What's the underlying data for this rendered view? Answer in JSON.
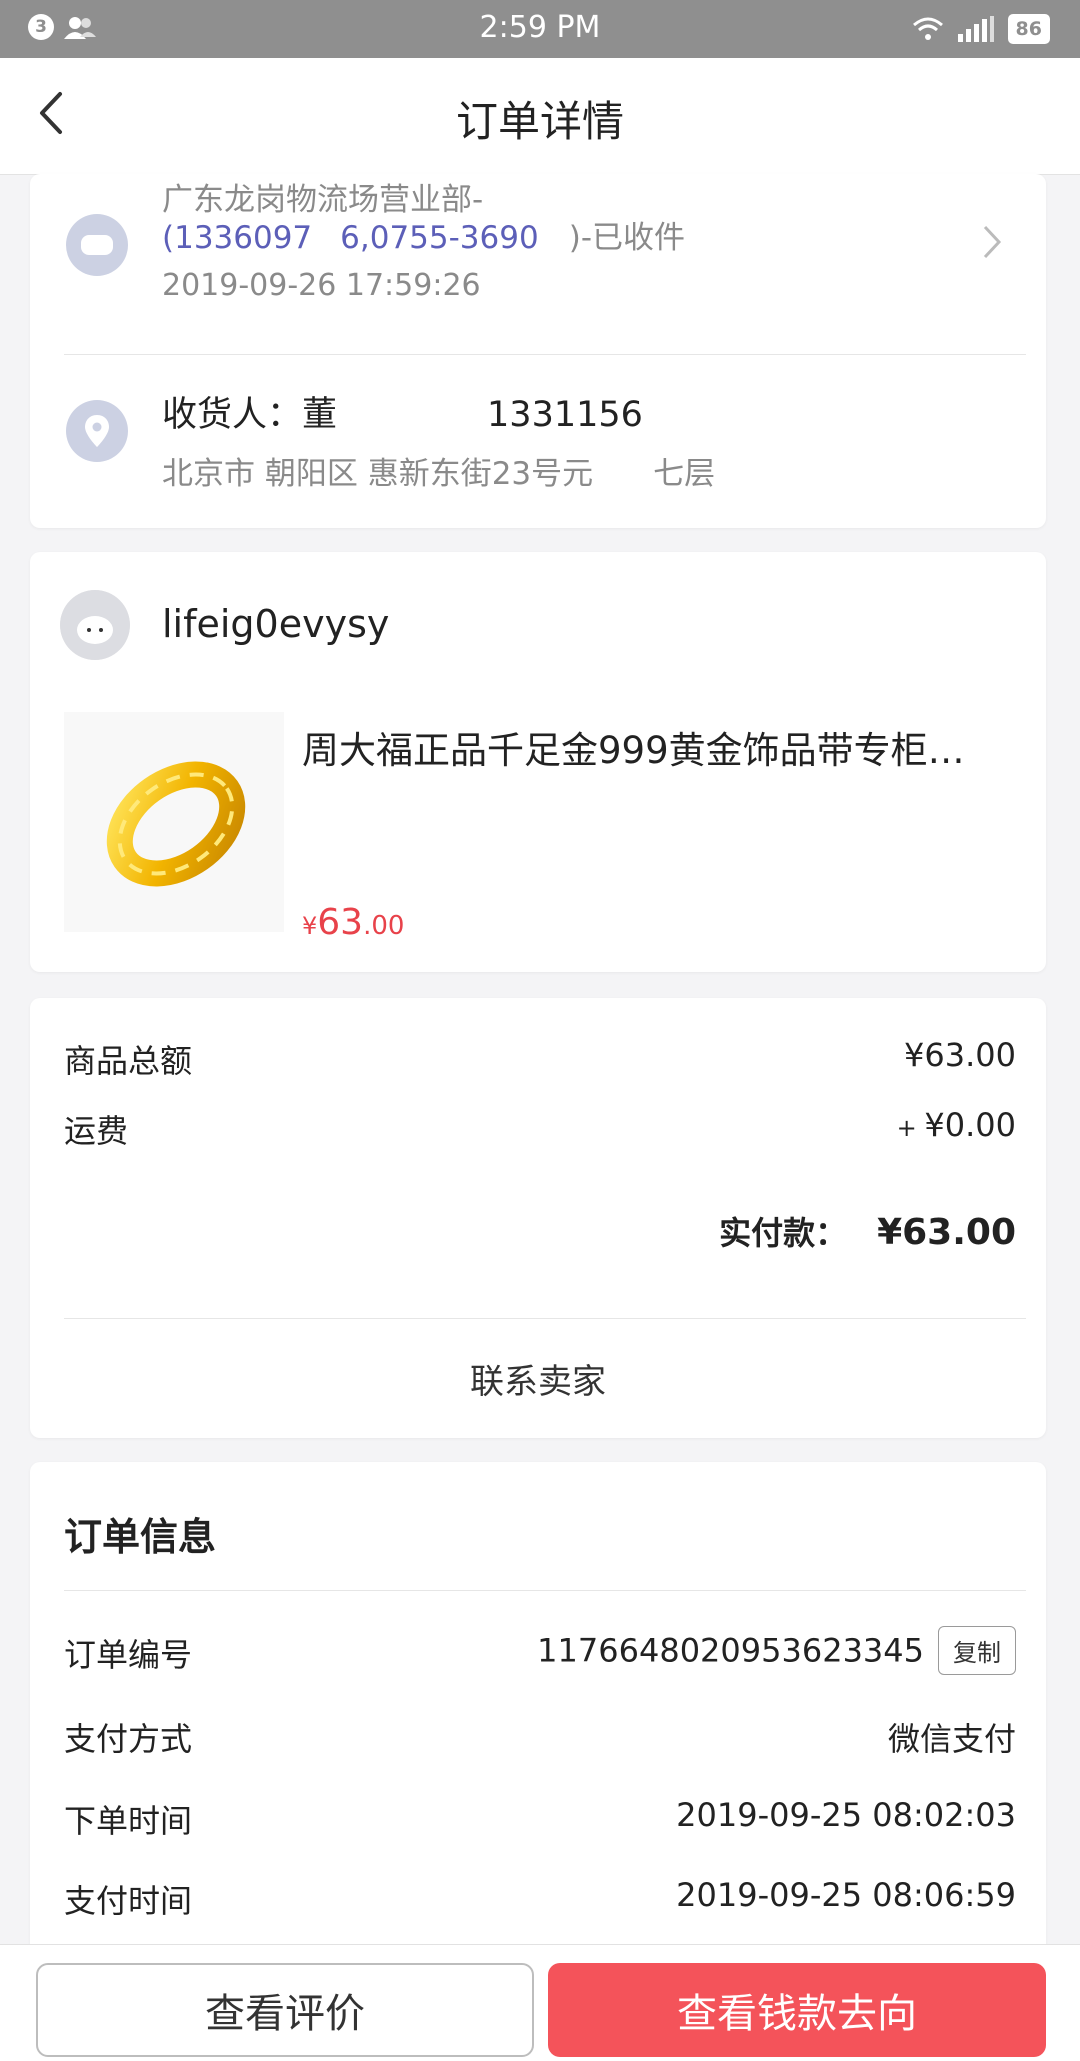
{
  "status_bar": {
    "notification_count": "3",
    "time": "2:59 PM",
    "battery": "86"
  },
  "nav": {
    "title": "订单详情"
  },
  "logistics": {
    "line1": "广东龙岗物流场营业部-",
    "line2_phone": "(1336097",
    "line2_tel": "6,0755-3690",
    "line2_status": ")-已收件",
    "time": "2019-09-26 17:59:26"
  },
  "recipient": {
    "label": "收货人：",
    "name": "董",
    "phone": "1331156",
    "address": "北京市 朝阳区 惠新东街23号元",
    "address_tail": "七层"
  },
  "shop": {
    "name": "lifeig0evysy"
  },
  "product": {
    "title": "周大福正品千足金999黄金饰品带专柜…",
    "price_symbol": "¥",
    "price_int": "63",
    "price_dec": ".00"
  },
  "summary": {
    "goods_total_label": "商品总额",
    "goods_total_value": "¥63.00",
    "shipping_label": "运费",
    "shipping_prefix": "+ ",
    "shipping_value": "¥0.00",
    "paid_label": "实付款：",
    "paid_value": "¥63.00",
    "contact_seller": "联系卖家"
  },
  "order_info": {
    "title": "订单信息",
    "rows": [
      {
        "label": "订单编号",
        "value": "1176648020953623345"
      },
      {
        "label": "支付方式",
        "value": "微信支付"
      },
      {
        "label": "下单时间",
        "value": "2019-09-25 08:02:03"
      },
      {
        "label": "支付时间",
        "value": "2019-09-25 08:06:59"
      }
    ],
    "copy_label": "复制"
  },
  "bottom_bar": {
    "view_review": "查看评价",
    "view_money_flow": "查看钱款去向"
  },
  "colors": {
    "accent_red": "#f4535a",
    "price_red": "#e8424a",
    "link_blue": "#5c5fb8",
    "icon_bg": "#ccd1e3"
  }
}
